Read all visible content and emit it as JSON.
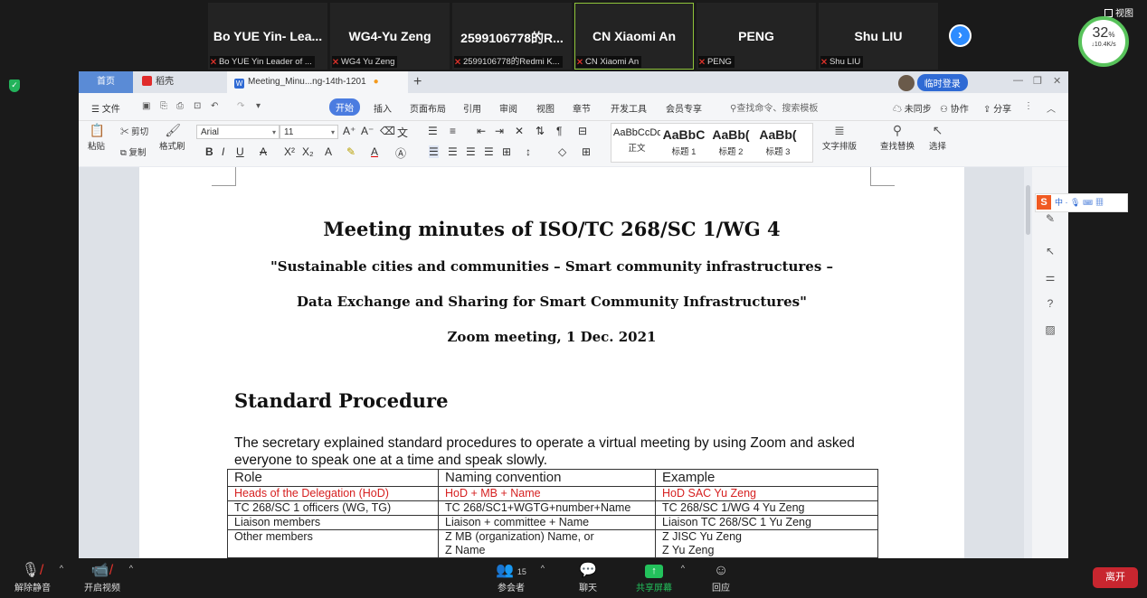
{
  "participants": [
    {
      "name": "Bo YUE Yin- Lea...",
      "label": "Bo YUE Yin  Leader of ..."
    },
    {
      "name": "WG4-Yu Zeng",
      "label": "WG4 Yu Zeng"
    },
    {
      "name": "2599106778的R...",
      "label": "2599106778的Redmi K..."
    },
    {
      "name": "CN Xiaomi An",
      "label": "CN Xiaomi An"
    },
    {
      "name": "PENG",
      "label": "PENG"
    },
    {
      "name": "Shu LIU",
      "label": "Shu LIU"
    }
  ],
  "view_label": "视图",
  "cpu": {
    "percent": "32",
    "unit": "%",
    "rate": "↓10.4K/s"
  },
  "wps": {
    "tabs": {
      "home": "首页",
      "daoke": "稻壳",
      "doc": "Meeting_Minu...ng-14th-1201"
    },
    "login": "临时登录",
    "menu": {
      "file": "文件",
      "items": [
        "开始",
        "插入",
        "页面布局",
        "引用",
        "审阅",
        "视图",
        "章节",
        "开发工具",
        "会员专享"
      ],
      "search": "查找命令、搜索模板",
      "sync": "未同步",
      "collab": "协作",
      "share": "分享"
    },
    "ribbon": {
      "paste": "粘贴",
      "cut": "剪切",
      "copy": "复制",
      "format_painter": "格式刷",
      "font": "Arial",
      "size": "11",
      "styles": [
        {
          "sample": "AaBbCcDd",
          "name": "正文"
        },
        {
          "sample": "AaBbC",
          "name": "标题 1"
        },
        {
          "sample": "AaBb(",
          "name": "标题 2"
        },
        {
          "sample": "AaBb(",
          "name": "标题 3"
        }
      ],
      "text_layout": "文字排版",
      "find_replace": "查找替换",
      "select": "选择"
    }
  },
  "document": {
    "title": "Meeting minutes of  ISO/TC 268/SC 1/WG 4",
    "subtitle1": "\"Sustainable cities and communities – Smart community infrastructures –",
    "subtitle2": "Data Exchange and Sharing for Smart Community Infrastructures\"",
    "meeting": "Zoom meeting, 1 Dec. 2021",
    "section": "Standard Procedure",
    "paragraph": "The secretary explained standard procedures to operate a virtual meeting by using Zoom and asked everyone to speak one at a time and speak slowly.",
    "table": {
      "headers": [
        "Role",
        "Naming convention",
        "Example"
      ],
      "rows": [
        [
          "Heads of the Delegation (HoD)",
          "HoD + MB + Name",
          "HoD SAC Yu Zeng"
        ],
        [
          "TC 268/SC 1 officers (WG, TG)",
          "TC 268/SC1+WGTG+number+Name",
          "TC 268/SC 1/WG 4 Yu Zeng"
        ],
        [
          "Liaison members",
          "Liaison + committee + Name",
          "Liaison TC 268/SC 1 Yu Zeng"
        ],
        [
          "Other members",
          "Z MB (organization) Name, or",
          "Z JISC Yu Zeng"
        ],
        [
          "",
          "Z Name",
          "Z Yu Zeng"
        ]
      ]
    }
  },
  "ime": {
    "lang": "中"
  },
  "toolbar": {
    "unmute": "解除静音",
    "start_video": "开启视频",
    "participants": "参会者",
    "participant_count": "15",
    "chat": "聊天",
    "share_screen": "共享屏幕",
    "reactions": "回应",
    "leave": "离开"
  },
  "colors": {
    "accent": "#2d8cff",
    "share_green": "#23c25c",
    "leave_red": "#c8262f",
    "wps_blue": "#4b7ce0",
    "doc_red": "#d62020"
  }
}
